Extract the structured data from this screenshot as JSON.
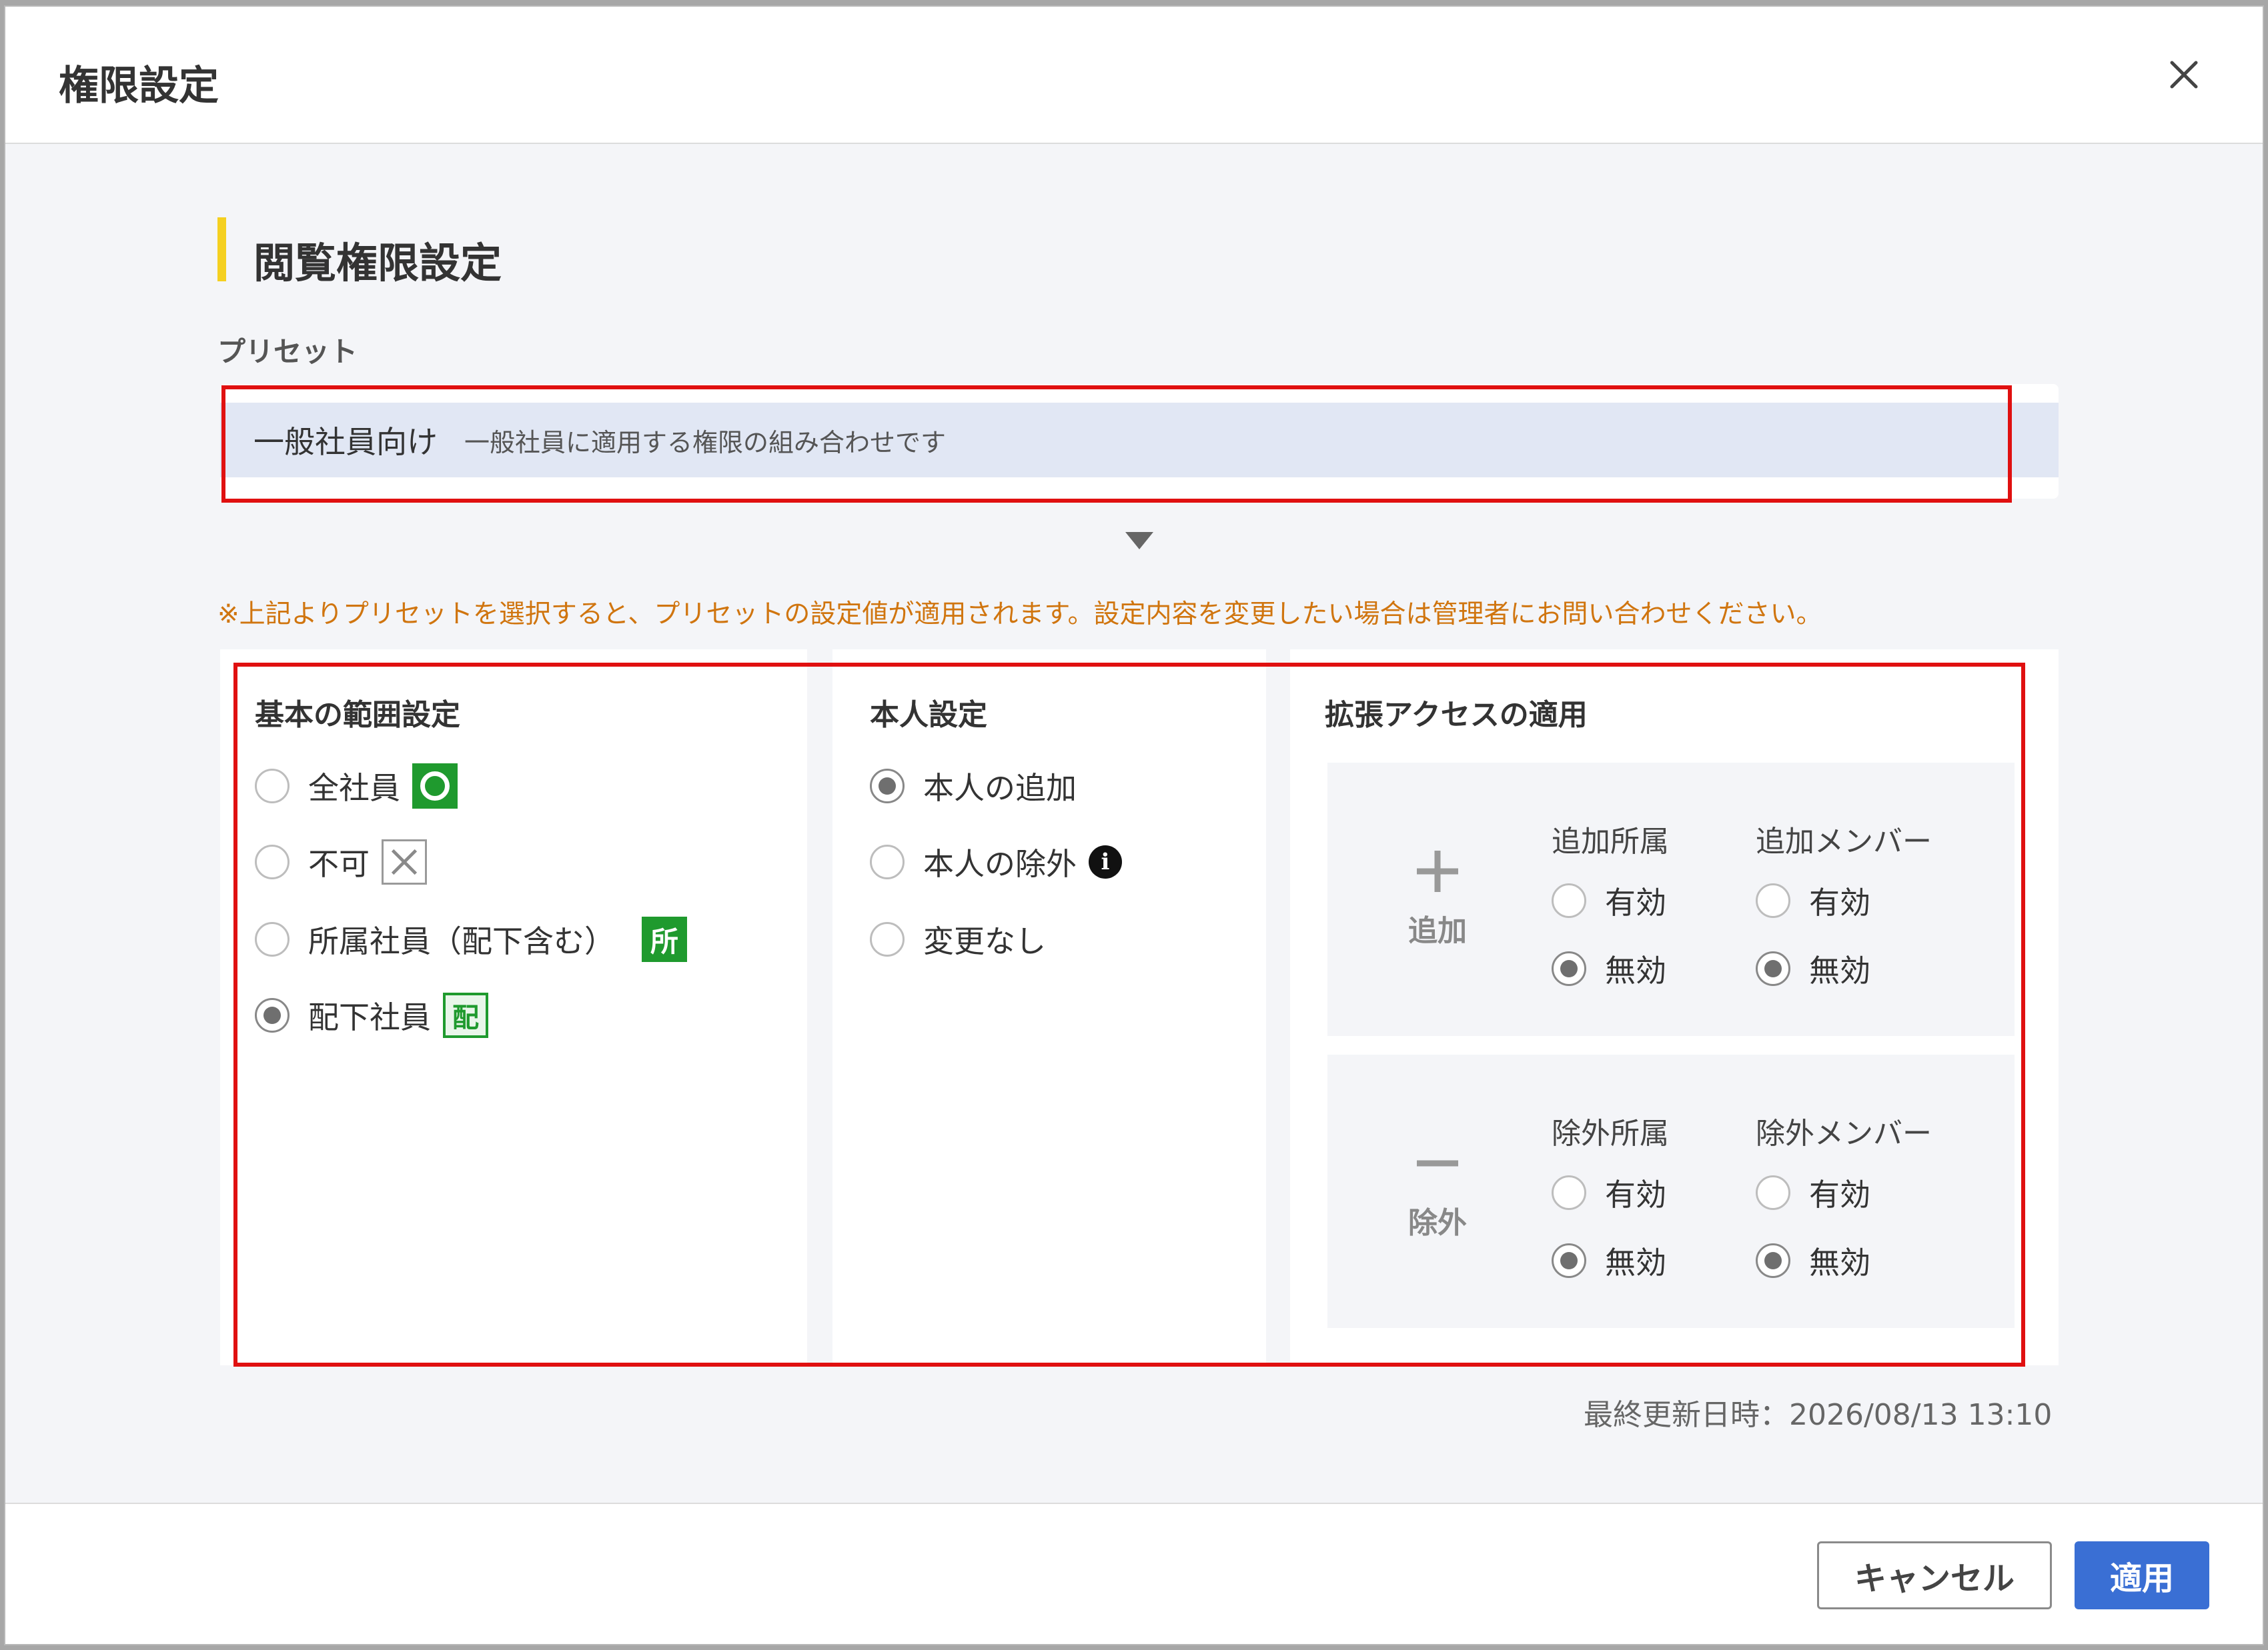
{
  "dialog": {
    "title": "権限設定",
    "close_icon": "close-icon"
  },
  "section": {
    "title": "閲覧権限設定"
  },
  "preset": {
    "label": "プリセット",
    "selected_name": "一般社員向け",
    "selected_description": "一般社員に適用する権限の組み合わせです"
  },
  "notice": "※上記よりプリセットを選択すると、プリセットの設定値が適用されます。設定内容を変更したい場合は管理者にお問い合わせください。",
  "basic_scope": {
    "heading": "基本の範囲設定",
    "options": [
      {
        "label": "全社員",
        "checked": false,
        "badge": "○"
      },
      {
        "label": "不可",
        "checked": false,
        "badge": "×"
      },
      {
        "label": "所属社員（配下含む）",
        "checked": false,
        "badge": "所"
      },
      {
        "label": "配下社員",
        "checked": true,
        "badge": "配"
      }
    ]
  },
  "self_setting": {
    "heading": "本人設定",
    "options": [
      {
        "label": "本人の追加",
        "checked": true
      },
      {
        "label": "本人の除外",
        "checked": false,
        "info_icon": "i"
      },
      {
        "label": "変更なし",
        "checked": false
      }
    ]
  },
  "extended_access": {
    "heading": "拡張アクセスの適用",
    "add": {
      "label": "追加",
      "icon": "plus-icon",
      "dept": {
        "heading": "追加所属",
        "enabled_label": "有効",
        "disabled_label": "無効",
        "selected": "無効"
      },
      "member": {
        "heading": "追加メンバー",
        "enabled_label": "有効",
        "disabled_label": "無効",
        "selected": "無効"
      }
    },
    "exclude": {
      "label": "除外",
      "icon": "minus-icon",
      "dept": {
        "heading": "除外所属",
        "enabled_label": "有効",
        "disabled_label": "無効",
        "selected": "無効"
      },
      "member": {
        "heading": "除外メンバー",
        "enabled_label": "有効",
        "disabled_label": "無効",
        "selected": "無効"
      }
    }
  },
  "last_updated": "最終更新日時：2026/08/13 13:10",
  "footer": {
    "cancel_label": "キャンセル",
    "apply_label": "適用"
  },
  "colors": {
    "accent_bar": "#f5d020",
    "primary_button": "#3a6fd4",
    "notice_text": "#d0750f",
    "highlight": "#e01010",
    "badge_green": "#1f9a2e"
  }
}
